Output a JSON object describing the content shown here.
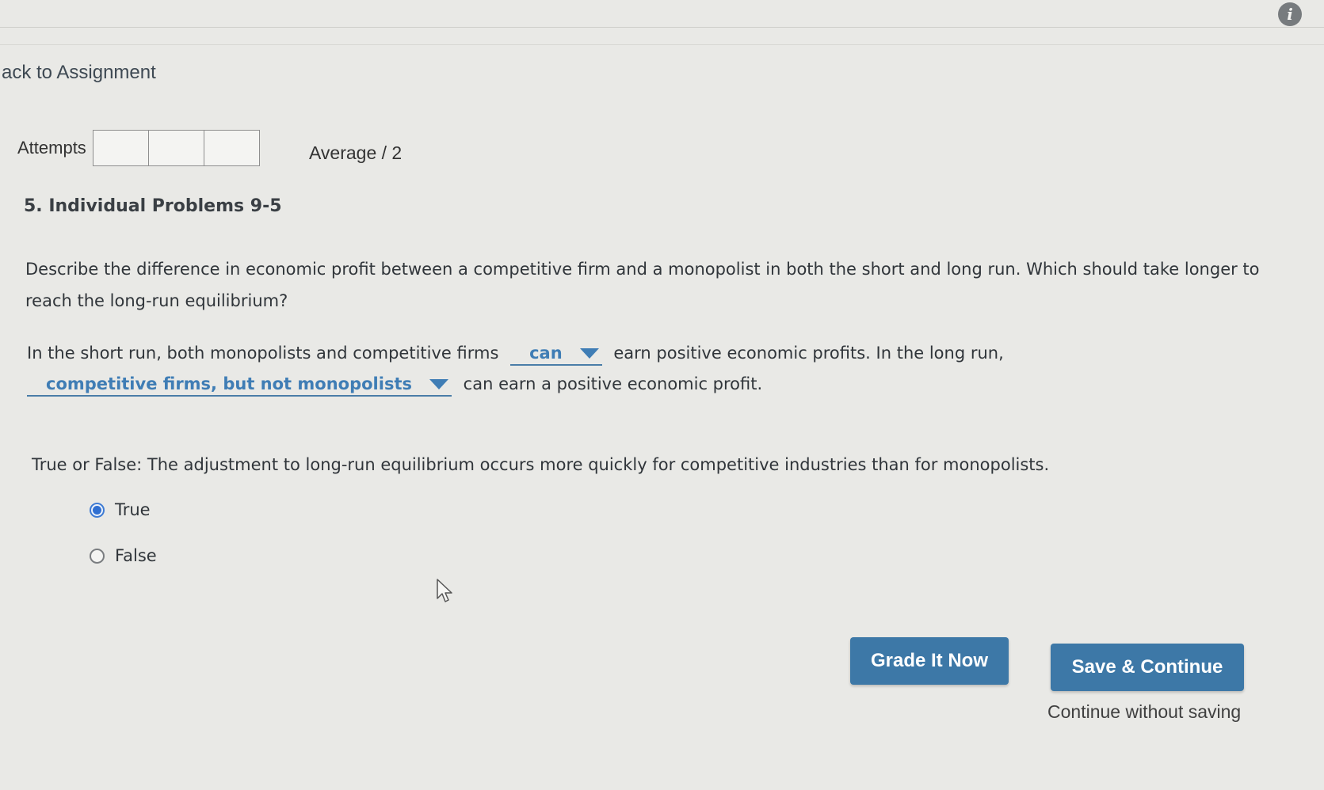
{
  "header": {
    "back_link": "ack to Assignment",
    "info_icon": "i"
  },
  "attempts": {
    "label": "Attempts",
    "box_count": 3,
    "average": "Average / 2"
  },
  "problem": {
    "title": "5. Individual Problems 9-5",
    "description": "Describe the difference in economic profit between a competitive firm and a monopolist in both the short and long run. Which should take longer to reach the long-run equilibrium?",
    "sentence1_before": "In the short run, both monopolists and competitive firms",
    "dropdown1": "can",
    "sentence1_after": "earn positive economic profits. In the long run,",
    "dropdown2": "competitive firms, but not monopolists",
    "sentence2_after": "can earn a positive economic profit.",
    "tf_question": "True or False: The adjustment to long-run equilibrium occurs more quickly for competitive industries than for monopolists.",
    "options": [
      {
        "label": "True",
        "selected": true
      },
      {
        "label": "False",
        "selected": false
      }
    ]
  },
  "actions": {
    "grade_label": "Grade It Now",
    "save_label": "Save & Continue",
    "continue_label": "Continue without saving"
  },
  "colors": {
    "accent": "#3d78a7",
    "dropdown_text": "#3f7db5",
    "radio_selected": "#2f6fd1"
  }
}
